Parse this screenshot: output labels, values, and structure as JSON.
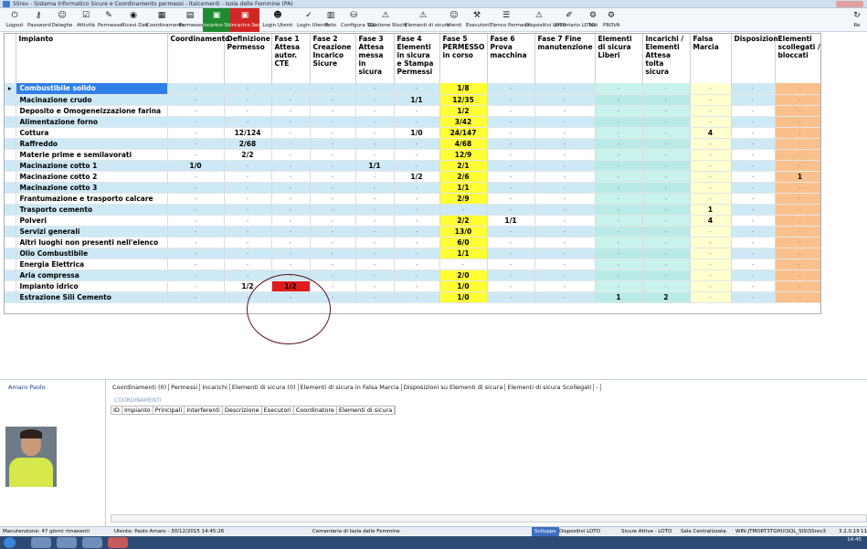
{
  "window": {
    "title": "SSrev - Sistema Informatico Sicure e Coordinamento permessi - Italcementi - Isola delle Femmine (PA)"
  },
  "toolbar": [
    {
      "label": "Logout",
      "icon": "power-icon"
    },
    {
      "label": "Password",
      "icon": "key-icon"
    },
    {
      "label": "Deleghe",
      "icon": "people-icon"
    },
    {
      "label": "Attività",
      "icon": "task-icon"
    },
    {
      "label": "Permesso",
      "icon": "permit-icon"
    },
    {
      "label": "Ricevi Dati",
      "icon": "binoculars-icon"
    },
    {
      "label": "Coordinamento",
      "icon": "coordination-icon"
    },
    {
      "label": "Permesso",
      "icon": "document-icon"
    },
    {
      "label": "Incarico Sicuro",
      "icon": "lock-icon",
      "style": "green"
    },
    {
      "label": "Incarico Servizio",
      "icon": "service-icon",
      "style": "red"
    },
    {
      "label": "Login Utenti",
      "icon": "login-icon"
    },
    {
      "label": "Login Utente",
      "icon": "user-login-icon"
    },
    {
      "label": "Foto",
      "icon": "photo-icon"
    },
    {
      "label": "Configura SQL",
      "icon": "sql-icon"
    },
    {
      "label": "Gestione Rischi",
      "icon": "warning-icon"
    },
    {
      "label": "Elementi di sicura",
      "icon": "warning-icon"
    },
    {
      "label": "Utenti",
      "icon": "users-icon"
    },
    {
      "label": "Esecutori",
      "icon": "executors-icon"
    },
    {
      "label": "Elenco Permessi",
      "icon": "list-icon"
    },
    {
      "label": "Dispositivi LOTO",
      "icon": "warning-icon"
    },
    {
      "label": "Inventario LOTO",
      "icon": "inventory-icon"
    },
    {
      "label": "Test",
      "icon": "test-icon"
    },
    {
      "label": "PROVA",
      "icon": "prova-icon"
    },
    {
      "label": "Re",
      "icon": "refresh-icon"
    }
  ],
  "grid": {
    "columns": [
      "Impianto",
      "Coordinamento",
      "Definizione Permesso",
      "Fase 1 Attesa autor. CTE",
      "Fase 2 Creazione Incarico Sicure",
      "Fase 3 Attesa messa in sicura",
      "Fase 4 Elementi in sicura e Stampa Permessi",
      "Fase 5 PERMESSO in corso",
      "Fase 6 Prova macchina",
      "Fase 7 Fine manutenzione",
      "Elementi di sicura Liberi",
      "Incarichi / Elementi Attesa tolta sicura",
      "Falsa Marcia",
      "Disposizioni",
      "Elementi scollegati / bloccati"
    ],
    "rows": [
      {
        "name": "Combustibile solido",
        "cells": [
          "-",
          "-",
          "-",
          "-",
          "-",
          "-",
          "1/8",
          "-",
          "-",
          "-",
          "-",
          "-",
          "-",
          "-"
        ]
      },
      {
        "name": "Macinazione crudo",
        "cells": [
          "-",
          "-",
          "-",
          "-",
          "-",
          "1/1",
          "12/35",
          "-",
          "-",
          "-",
          "-",
          "-",
          "-",
          "-"
        ]
      },
      {
        "name": "Deposito e Omogeneizzazione farina",
        "cells": [
          "-",
          "-",
          "-",
          "-",
          "-",
          "-",
          "1/2",
          "-",
          "-",
          "-",
          "-",
          "-",
          "-",
          "-"
        ]
      },
      {
        "name": "Alimentazione forno",
        "cells": [
          "-",
          "-",
          "-",
          "-",
          "-",
          "-",
          "3/42",
          "-",
          "-",
          "-",
          "-",
          "-",
          "-",
          "-"
        ]
      },
      {
        "name": "Cottura",
        "cells": [
          "-",
          "12/124",
          "-",
          "-",
          "-",
          "1/0",
          "24/147",
          "-",
          "-",
          "-",
          "-",
          "4",
          "-",
          "-"
        ]
      },
      {
        "name": "Raffreddo",
        "cells": [
          "-",
          "2/68",
          "-",
          "-",
          "-",
          "-",
          "4/68",
          "-",
          "-",
          "-",
          "-",
          "-",
          "-",
          "-"
        ]
      },
      {
        "name": "Materie prime e semilavorati",
        "cells": [
          "-",
          "2/2",
          "-",
          "-",
          "-",
          "-",
          "12/9",
          "-",
          "-",
          "-",
          "-",
          "-",
          "-",
          "-"
        ]
      },
      {
        "name": "Macinazione cotto 1",
        "cells": [
          "1/0",
          "-",
          "-",
          "-",
          "1/1",
          "-",
          "2/1",
          "-",
          "-",
          "-",
          "-",
          "-",
          "-",
          "-"
        ]
      },
      {
        "name": "Macinazione cotto 2",
        "cells": [
          "-",
          "-",
          "-",
          "-",
          "-",
          "1/2",
          "2/6",
          "-",
          "-",
          "-",
          "-",
          "-",
          "-",
          "1"
        ]
      },
      {
        "name": "Macinazione cotto 3",
        "cells": [
          "-",
          "-",
          "-",
          "-",
          "-",
          "-",
          "1/1",
          "-",
          "-",
          "-",
          "-",
          "-",
          "-",
          "-"
        ]
      },
      {
        "name": "Frantumazione e trasporto calcare",
        "cells": [
          "-",
          "-",
          "-",
          "-",
          "-",
          "-",
          "2/9",
          "-",
          "-",
          "-",
          "-",
          "-",
          "-",
          "-"
        ]
      },
      {
        "name": "Trasporto cemento",
        "cells": [
          "-",
          "-",
          "-",
          "-",
          "-",
          "-",
          "-",
          "-",
          "-",
          "-",
          "-",
          "1",
          "-",
          "-"
        ]
      },
      {
        "name": "Polveri",
        "cells": [
          "-",
          "-",
          "-",
          "-",
          "-",
          "-",
          "2/2",
          "1/1",
          "-",
          "-",
          "-",
          "4",
          "-",
          "-"
        ]
      },
      {
        "name": "Servizi generali",
        "cells": [
          "-",
          "-",
          "-",
          "-",
          "-",
          "-",
          "13/0",
          "-",
          "-",
          "-",
          "-",
          "-",
          "-",
          "-"
        ]
      },
      {
        "name": "Altri luoghi non presenti nell'elenco",
        "cells": [
          "-",
          "-",
          "-",
          "-",
          "-",
          "-",
          "6/0",
          "-",
          "-",
          "-",
          "-",
          "-",
          "-",
          "-"
        ]
      },
      {
        "name": "Olio Combustibile",
        "cells": [
          "-",
          "-",
          "-",
          "-",
          "-",
          "-",
          "1/1",
          "-",
          "-",
          "-",
          "-",
          "-",
          "-",
          "-"
        ]
      },
      {
        "name": "Energia Elettrica",
        "cells": [
          "-",
          "-",
          "-",
          "-",
          "-",
          "-",
          "-",
          "-",
          "-",
          "-",
          "-",
          "-",
          "-",
          "-"
        ]
      },
      {
        "name": "Aria compressa",
        "cells": [
          "-",
          "-",
          "-",
          "-",
          "-",
          "-",
          "2/0",
          "-",
          "-",
          "-",
          "-",
          "-",
          "-",
          "-"
        ]
      },
      {
        "name": "Impianto idrico",
        "cells": [
          "-",
          "1/2",
          "1/2",
          "-",
          "-",
          "-",
          "1/0",
          "-",
          "-",
          "-",
          "-",
          "-",
          "-",
          "-"
        ]
      },
      {
        "name": "Estrazione Sili Cemento",
        "cells": [
          "-",
          "-",
          "-",
          "-",
          "-",
          "-",
          "1/0",
          "-",
          "-",
          "1",
          "2",
          "-",
          "-",
          "-"
        ]
      }
    ]
  },
  "bottom": {
    "person": "Amaro Paolo",
    "tabs": [
      "Coordinamenti (0)",
      "Permessi",
      "Incarichi",
      "Elementi di sicura (0)",
      "Elementi di sicura in Falsa Marcia",
      "Disposizioni su Elementi di sicura",
      "Elementi di sicura Scollegati",
      "-"
    ],
    "section_label": "COORDINAMENTI",
    "coord_columns": [
      "ID",
      "Impianto",
      "Principali",
      "Interferenti",
      "Descrizione",
      "Esecutori",
      "Coordinatore",
      "Elementi di sicura"
    ]
  },
  "status": {
    "maint": "Manutenzione: 47 giorni rimanenti",
    "user": "Utente: Paolo Amaro - 30/12/2015 14:45:26",
    "site": "Cementeria di Isola delle Femmine",
    "env": "Sviluppo",
    "loto": "Dispositivi LOTO",
    "attive": "Sicure Attive - LOTO",
    "sala": "Sala Centralizzata",
    "server": "WIN-JTMO8T3TGHU\\SQL_SIS\\SSrev3",
    "version": "3.2.0.19",
    "ext": "11"
  },
  "taskbar": {
    "time": "14:45"
  }
}
